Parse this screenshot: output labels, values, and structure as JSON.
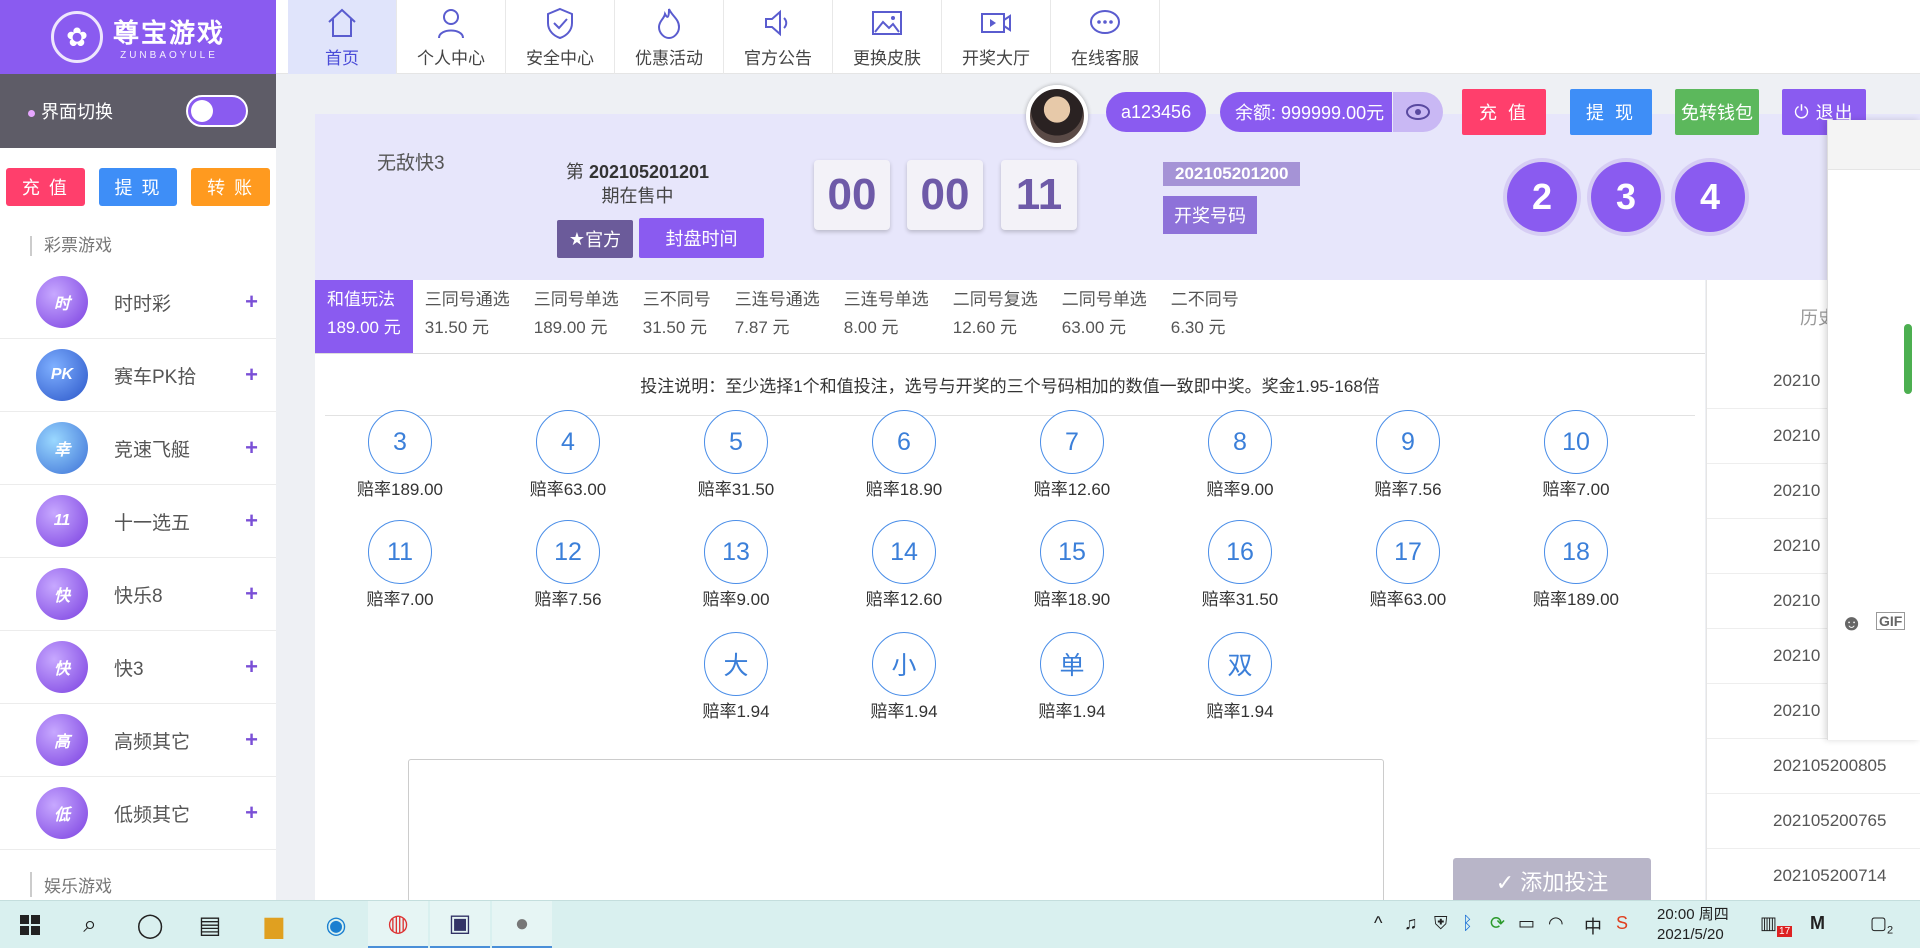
{
  "brand": {
    "name": "尊宝游戏",
    "en": "ZUNBAOYULE",
    "colors": {
      "primary": "#8a5bf0",
      "recharge": "#ff3f6c",
      "withdraw": "#3e8ef7",
      "transfer": "#ff9a1f",
      "wallet": "#5cb85c"
    }
  },
  "sidebar": {
    "switch_label": "界面切换",
    "buttons": [
      "充 值",
      "提 现",
      "转 账"
    ],
    "section_lottery": "彩票游戏",
    "items": [
      {
        "label": "时时彩",
        "icon": "时"
      },
      {
        "label": "赛车PK拾",
        "icon": "PK"
      },
      {
        "label": "竞速飞艇",
        "icon": "幸"
      },
      {
        "label": "十一选五",
        "icon": "11"
      },
      {
        "label": "快乐8",
        "icon": "快"
      },
      {
        "label": "快3",
        "icon": "快"
      },
      {
        "label": "高频其它",
        "icon": "高"
      },
      {
        "label": "低频其它",
        "icon": "低"
      }
    ],
    "section_ent": "娱乐游戏",
    "plus": "+"
  },
  "nav": {
    "items": [
      {
        "label": "首页",
        "icon": "home-icon"
      },
      {
        "label": "个人中心",
        "icon": "user-icon"
      },
      {
        "label": "安全中心",
        "icon": "shield-icon"
      },
      {
        "label": "优惠活动",
        "icon": "fire-icon"
      },
      {
        "label": "官方公告",
        "icon": "speaker-icon"
      },
      {
        "label": "更换皮肤",
        "icon": "image-icon"
      },
      {
        "label": "开奖大厅",
        "icon": "video-icon"
      },
      {
        "label": "在线客服",
        "icon": "chat-icon"
      }
    ]
  },
  "user": {
    "name": "a123456",
    "balance": "余额: 999999.00元",
    "recharge": "充 值",
    "withdraw": "提 现",
    "wallet": "免转钱包",
    "logout": "退出"
  },
  "game": {
    "name": "无敌快3",
    "issue_prefix": "第",
    "issue": "202105201201",
    "issue_suffix": "期在售中",
    "official": "官方",
    "fengpan": "封盘时间",
    "timer": [
      "00",
      "00",
      "11"
    ],
    "last_issue": "202105201200",
    "kj_button": "开奖号码",
    "balls": [
      "2",
      "3",
      "4"
    ]
  },
  "tabs": [
    {
      "name": "和值玩法",
      "odds": "189.00 元"
    },
    {
      "name": "三同号通选",
      "odds": "31.50 元"
    },
    {
      "name": "三同号单选",
      "odds": "189.00 元"
    },
    {
      "name": "三不同号",
      "odds": "31.50 元"
    },
    {
      "name": "三连号通选",
      "odds": "7.87 元"
    },
    {
      "name": "三连号单选",
      "odds": "8.00 元"
    },
    {
      "name": "二同号复选",
      "odds": "12.60 元"
    },
    {
      "name": "二同号单选",
      "odds": "63.00 元"
    },
    {
      "name": "二不同号",
      "odds": "6.30 元"
    }
  ],
  "instruction": "投注说明：至少选择1个和值投注，选号与开奖的三个号码相加的数值一致即中奖。奖金1.95-168倍",
  "numbers": [
    {
      "n": "3",
      "odds": "赔率189.00"
    },
    {
      "n": "4",
      "odds": "赔率63.00"
    },
    {
      "n": "5",
      "odds": "赔率31.50"
    },
    {
      "n": "6",
      "odds": "赔率18.90"
    },
    {
      "n": "7",
      "odds": "赔率12.60"
    },
    {
      "n": "8",
      "odds": "赔率9.00"
    },
    {
      "n": "9",
      "odds": "赔率7.56"
    },
    {
      "n": "10",
      "odds": "赔率7.00"
    },
    {
      "n": "11",
      "odds": "赔率7.00"
    },
    {
      "n": "12",
      "odds": "赔率7.56"
    },
    {
      "n": "13",
      "odds": "赔率9.00"
    },
    {
      "n": "14",
      "odds": "赔率12.60"
    },
    {
      "n": "15",
      "odds": "赔率18.90"
    },
    {
      "n": "16",
      "odds": "赔率31.50"
    },
    {
      "n": "17",
      "odds": "赔率63.00"
    },
    {
      "n": "18",
      "odds": "赔率189.00"
    },
    {
      "n": "大",
      "odds": "赔率1.94"
    },
    {
      "n": "小",
      "odds": "赔率1.94"
    },
    {
      "n": "单",
      "odds": "赔率1.94"
    },
    {
      "n": "双",
      "odds": "赔率1.94"
    }
  ],
  "add_bet": "✓ 添加投注",
  "history": {
    "head": "历史",
    "rows": [
      "20210",
      "20210",
      "20210",
      "20210",
      "20210",
      "20210",
      "20210",
      "202105200805",
      "202105200765",
      "202105200714"
    ]
  },
  "taskbar": {
    "time": "20:00 周四",
    "date": "2021/5/20",
    "ime": "中",
    "notif": "17",
    "msgs": "2"
  }
}
